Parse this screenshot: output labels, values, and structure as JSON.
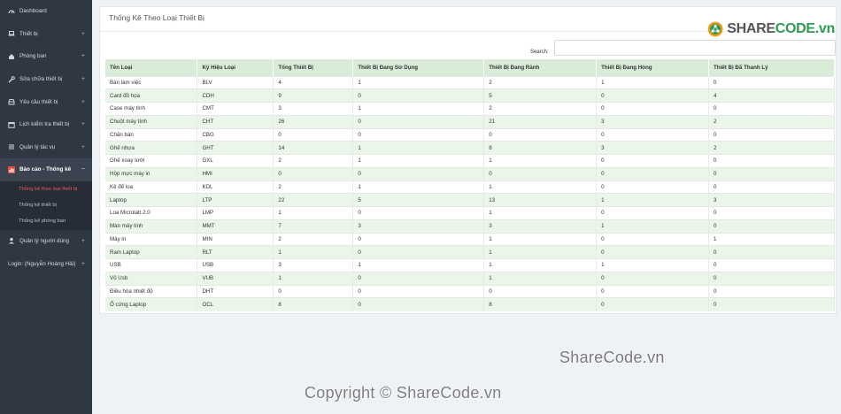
{
  "sidebar": {
    "items": [
      {
        "label": "Dashboard",
        "icon": "dashboard-icon",
        "expand": ""
      },
      {
        "label": "Thiết bị",
        "icon": "laptop-icon",
        "expand": "+"
      },
      {
        "label": "Phòng ban",
        "icon": "home-icon",
        "expand": "+"
      },
      {
        "label": "Sửa chữa thiết bị",
        "icon": "wrench-icon",
        "expand": "+"
      },
      {
        "label": "Yêu cầu thiết bị",
        "icon": "inbox-icon",
        "expand": "+"
      },
      {
        "label": "Lịch kiểm tra thiết bị",
        "icon": "calendar-icon",
        "expand": "+"
      },
      {
        "label": "Quản lý tác vụ",
        "icon": "list-icon",
        "expand": "+"
      }
    ],
    "report": {
      "label": "Báo cáo - Thống kê",
      "icon": "bar-chart-icon",
      "expand": "−"
    },
    "sub_items": [
      "Thống kê theo loại thiết bị",
      "Thống kê thiết bị",
      "Thống kê phòng ban"
    ],
    "bottom_items": [
      {
        "label": "Quản lý người dùng",
        "icon": "user-icon",
        "expand": "+"
      },
      {
        "label": "Login: (Nguyễn Hoàng Hải)",
        "icon": "",
        "expand": "+"
      }
    ]
  },
  "panel": {
    "title": "Thống Kê Theo Loại Thiết Bị",
    "logo_brand": "SHARE",
    "logo_code": "CODE",
    "logo_tld": ".vn",
    "search_label": "Search:",
    "search_value": ""
  },
  "table": {
    "columns": [
      "Tên Loại",
      "Ký Hiệu Loại",
      "Tổng Thiết Bị",
      "Thiết Bị Đang Sử Dụng",
      "Thiết Bị Đang Rảnh",
      "Thiết Bị Đang Hỏng",
      "Thiết Bị Đã Thanh Lý"
    ],
    "rows": [
      [
        "Bàn làm việc",
        "BLV",
        "4",
        "1",
        "2",
        "1",
        "0"
      ],
      [
        "Card đồ họa",
        "CDH",
        "9",
        "0",
        "5",
        "0",
        "4"
      ],
      [
        "Case máy tính",
        "CMT",
        "3",
        "1",
        "2",
        "0",
        "0"
      ],
      [
        "Chuột máy tính",
        "CHT",
        "26",
        "0",
        "21",
        "3",
        "2"
      ],
      [
        "Chăn bàn",
        "CBG",
        "0",
        "0",
        "0",
        "0",
        "0"
      ],
      [
        "Ghế nhựa",
        "GHT",
        "14",
        "1",
        "8",
        "3",
        "2"
      ],
      [
        "Ghế xoay lưới",
        "GXL",
        "2",
        "1",
        "1",
        "0",
        "0"
      ],
      [
        "Hộp mực máy in",
        "HMI",
        "0",
        "0",
        "0",
        "0",
        "0"
      ],
      [
        "Kệ để loa",
        "KDL",
        "2",
        "1",
        "1",
        "0",
        "0"
      ],
      [
        "Laptop",
        "LTP",
        "22",
        "5",
        "13",
        "1",
        "3"
      ],
      [
        "Loa Microlab 2.0",
        "LMP",
        "1",
        "0",
        "1",
        "0",
        "0"
      ],
      [
        "Màn máy tính",
        "MMT",
        "7",
        "3",
        "3",
        "1",
        "0"
      ],
      [
        "Máy in",
        "MIN",
        "2",
        "0",
        "1",
        "0",
        "1"
      ],
      [
        "Ram Laptop",
        "RLT",
        "1",
        "0",
        "1",
        "0",
        "0"
      ],
      [
        "USB",
        "USB",
        "3",
        "1",
        "1",
        "1",
        "0"
      ],
      [
        "Vỏ Usb",
        "VUB",
        "1",
        "0",
        "1",
        "0",
        "0"
      ],
      [
        "Điều hòa nhiệt độ",
        "DHT",
        "0",
        "0",
        "0",
        "0",
        "0"
      ],
      [
        "Ổ cứng Laptop",
        "OCL",
        "8",
        "0",
        "8",
        "0",
        "0"
      ]
    ]
  },
  "watermarks": {
    "mid": "ShareCode.vn",
    "bottom": "Copyright © ShareCode.vn"
  },
  "colors": {
    "sidebar_bg": "#2f3743",
    "active_sub": "#f2545b",
    "header_row": "#d8ecd8",
    "stripe": "#ebf6eb",
    "brand_green": "#2d9b52",
    "brand_orange": "#f39c12"
  }
}
